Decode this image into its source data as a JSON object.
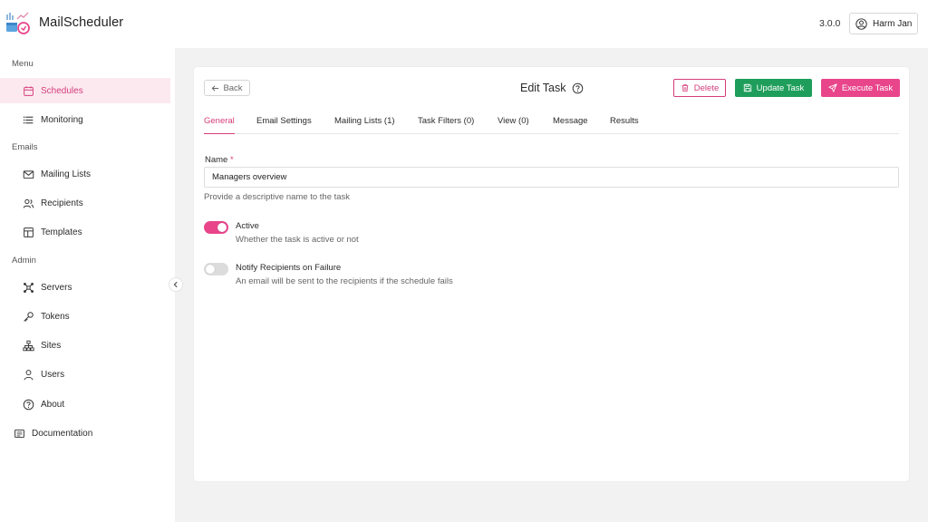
{
  "app": {
    "name": "MailScheduler",
    "version": "3.0.0",
    "user": "Harm Jan"
  },
  "sidebar": {
    "sections": [
      {
        "label": "Menu"
      },
      {
        "label": "Emails"
      },
      {
        "label": "Admin"
      }
    ],
    "items": [
      {
        "label": "Schedules",
        "icon": "calendar-icon",
        "active": true
      },
      {
        "label": "Monitoring",
        "icon": "list-icon"
      },
      {
        "label": "Mailing Lists",
        "icon": "mail-icon"
      },
      {
        "label": "Recipients",
        "icon": "users-icon"
      },
      {
        "label": "Templates",
        "icon": "template-icon"
      },
      {
        "label": "Servers",
        "icon": "servers-icon"
      },
      {
        "label": "Tokens",
        "icon": "key-icon"
      },
      {
        "label": "Sites",
        "icon": "sitemap-icon"
      },
      {
        "label": "Users",
        "icon": "user-icon"
      },
      {
        "label": "About",
        "icon": "help-circle-icon"
      },
      {
        "label": "Documentation",
        "icon": "book-icon"
      }
    ]
  },
  "header": {
    "back_label": "Back",
    "title": "Edit Task",
    "delete_label": "Delete",
    "update_label": "Update Task",
    "execute_label": "Execute Task"
  },
  "tabs": [
    {
      "label": "General",
      "active": true
    },
    {
      "label": "Email Settings"
    },
    {
      "label": "Mailing Lists (1)"
    },
    {
      "label": "Task Filters (0)"
    },
    {
      "label": "View (0)"
    },
    {
      "label": "Message"
    },
    {
      "label": "Results"
    }
  ],
  "form": {
    "name_label": "Name",
    "required_mark": "*",
    "name_value": "Managers overview",
    "name_help": "Provide a descriptive name to the task",
    "active_title": "Active",
    "active_desc": "Whether the task is active or not",
    "active_on": true,
    "notify_title": "Notify Recipients on Failure",
    "notify_desc": "An email will be sent to the recipients if the schedule fails",
    "notify_on": false
  },
  "colors": {
    "accent": "#e8458b",
    "accent_text": "#d63d7c",
    "success": "#1e9e5a",
    "content_bg": "#f2f2f3"
  }
}
